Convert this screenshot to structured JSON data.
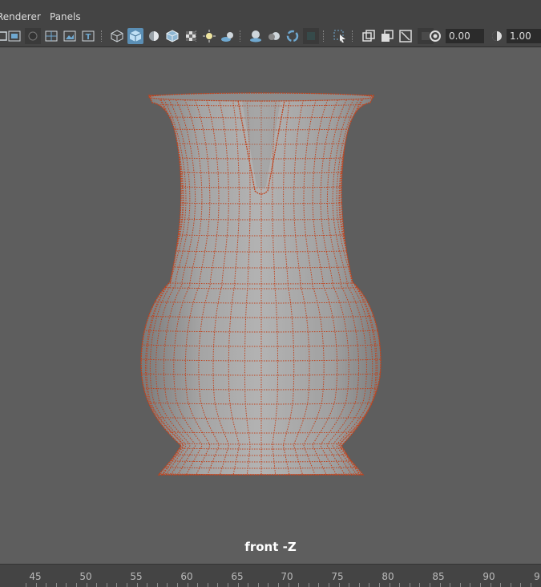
{
  "menu": {
    "items": [
      "Renderer",
      "Panels"
    ]
  },
  "toolbar": {
    "icons": [
      "xray-joints-icon",
      "wireframe-shaded-icon",
      "isolate-select-icon",
      "grid-icon",
      "image-plane-icon",
      "text-icon",
      "wireframe-cube-icon",
      "shaded-cube-icon",
      "use-default-material-icon",
      "wireframe-on-shaded-icon",
      "xray-icon",
      "lights-icon",
      "shadows-icon",
      "ambient-occlusion-icon",
      "motion-blur-icon",
      "anti-alias-icon",
      "depth-of-field-icon",
      "select-camera-icon",
      "resolution-gate-icon",
      "film-gate-icon",
      "safe-frame-icon",
      "gate-mask-icon",
      "exposure-icon",
      "gamma-icon"
    ],
    "exposure_value": "0.00",
    "gamma_value": "1.00"
  },
  "viewport": {
    "camera_label": "front -Z"
  },
  "timeline": {
    "ticks": [
      "45",
      "50",
      "55",
      "60",
      "65",
      "70",
      "75",
      "80",
      "85",
      "90",
      "9"
    ]
  },
  "colors": {
    "wire": "#c0431d",
    "accent": "#5b8fb5"
  }
}
